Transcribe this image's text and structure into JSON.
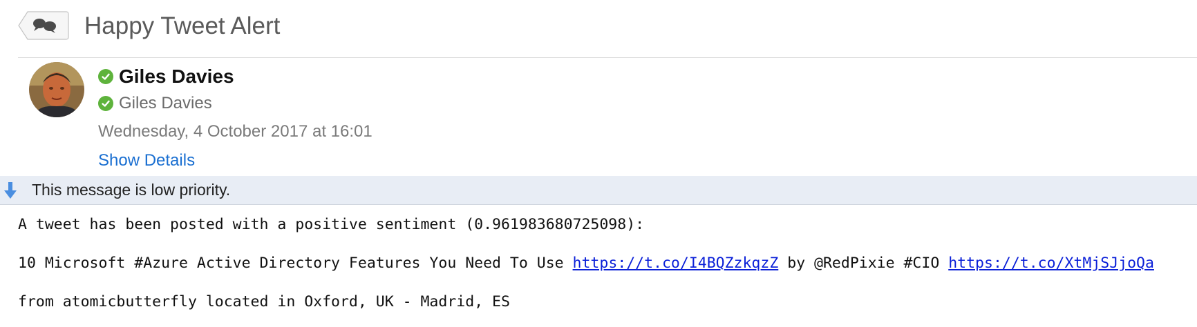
{
  "header": {
    "subject": "Happy Tweet Alert",
    "conversation_icon": "speech-bubbles-icon"
  },
  "sender": {
    "name": "Giles Davies",
    "status_icon": "verified-check-icon",
    "status_color": "#5eb33c"
  },
  "recipient": {
    "name": "Giles Davies",
    "status_icon": "verified-check-icon"
  },
  "date": "Wednesday, 4 October 2017 at 16:01",
  "show_details_label": "Show Details",
  "priority": {
    "icon": "down-arrow-icon",
    "text": "This message is low priority."
  },
  "body": {
    "line1": "A tweet has been posted with a positive sentiment (0.961983680725098):",
    "line2_prefix": "10 Microsoft #Azure Active Directory Features You Need To Use ",
    "line2_link1": "https://t.co/I4BQZzkqzZ",
    "line2_middle": " by @RedPixie #CIO ",
    "line2_link2": "https://t.co/XtMjSJjoQa",
    "line3": "from atomicbutterfly located in Oxford, UK - Madrid, ES"
  },
  "colors": {
    "link": "#0a1fd8",
    "show_details": "#1a6fd1",
    "priority_bar": "#e8edf5",
    "priority_arrow": "#4a8ee0"
  }
}
